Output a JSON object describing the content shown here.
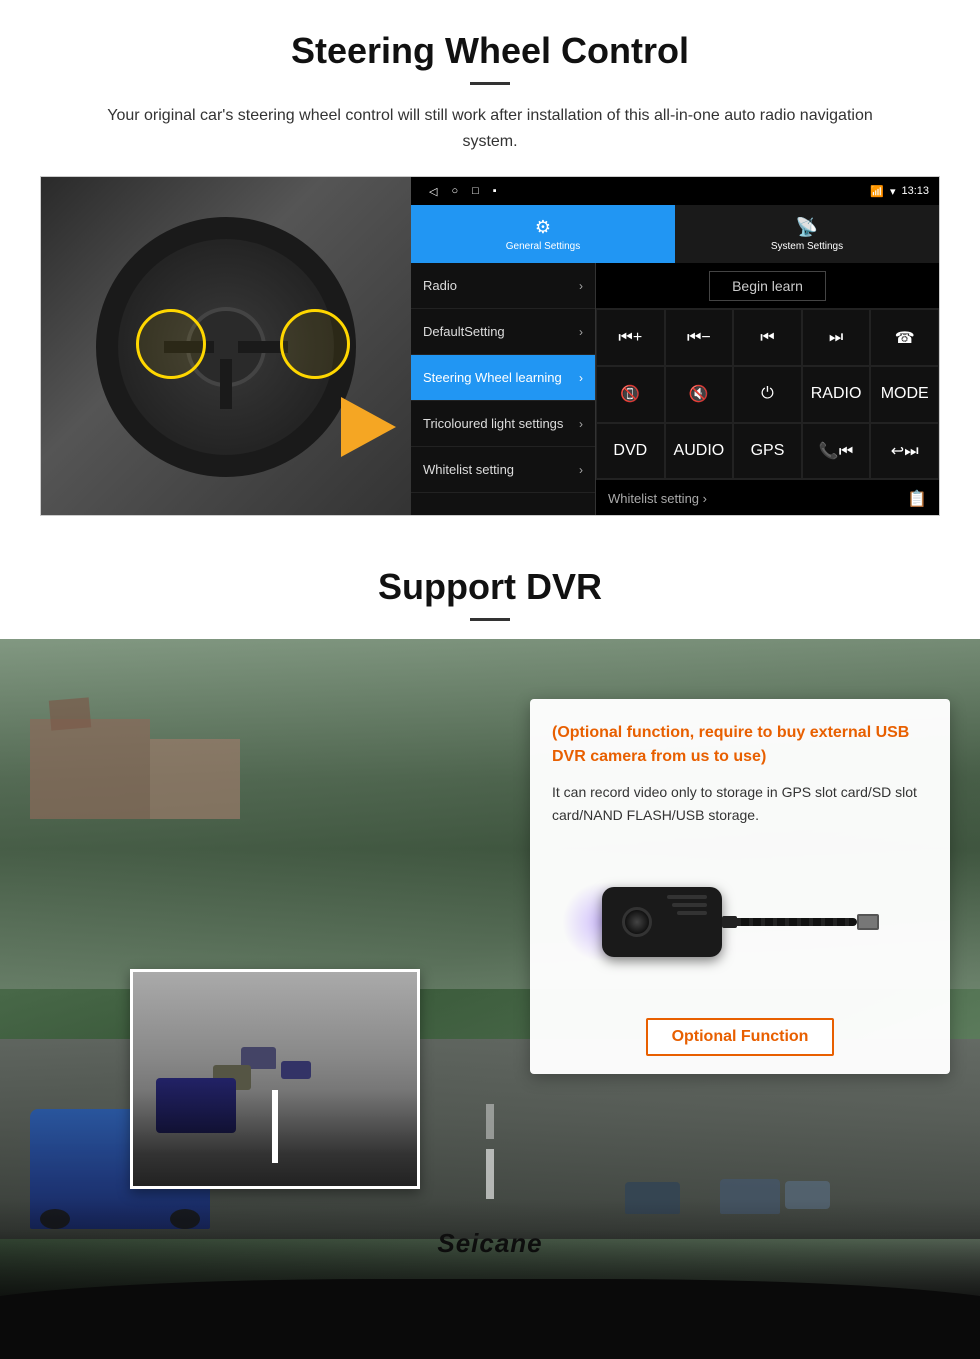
{
  "steering": {
    "title": "Steering Wheel Control",
    "subtitle": "Your original car's steering wheel control will still work after installation of this all-in-one auto radio navigation system.",
    "statusbar": {
      "nav_back": "◁",
      "nav_home": "○",
      "nav_square": "□",
      "nav_menu": "▪",
      "signal": "▼",
      "wifi": "▾",
      "time": "13:13"
    },
    "tabs": [
      {
        "icon": "⚙",
        "label": "General Settings",
        "active": true
      },
      {
        "icon": "☎",
        "label": "System Settings",
        "active": false
      }
    ],
    "menu_items": [
      {
        "label": "Radio",
        "active": false
      },
      {
        "label": "DefaultSetting",
        "active": false
      },
      {
        "label": "Steering Wheel learning",
        "active": true
      },
      {
        "label": "Tricoloured light settings",
        "active": false
      },
      {
        "label": "Whitelist setting",
        "active": false
      }
    ],
    "begin_learn": "Begin learn",
    "buttons_row1": [
      "⏮+",
      "⏮−",
      "⏮",
      "⏭",
      "☎"
    ],
    "buttons_row2": [
      "📞",
      "🔇",
      "⏻",
      "RADIO",
      "MODE"
    ],
    "buttons_row3": [
      "DVD",
      "AUDIO",
      "GPS",
      "📞⏮",
      "↩⏭"
    ]
  },
  "dvr": {
    "title": "Support DVR",
    "info_title": "(Optional function, require to buy external USB DVR camera from us to use)",
    "info_text": "It can record video only to storage in GPS slot card/SD slot card/NAND FLASH/USB storage.",
    "optional_btn": "Optional Function",
    "seicane": "Seicane"
  }
}
